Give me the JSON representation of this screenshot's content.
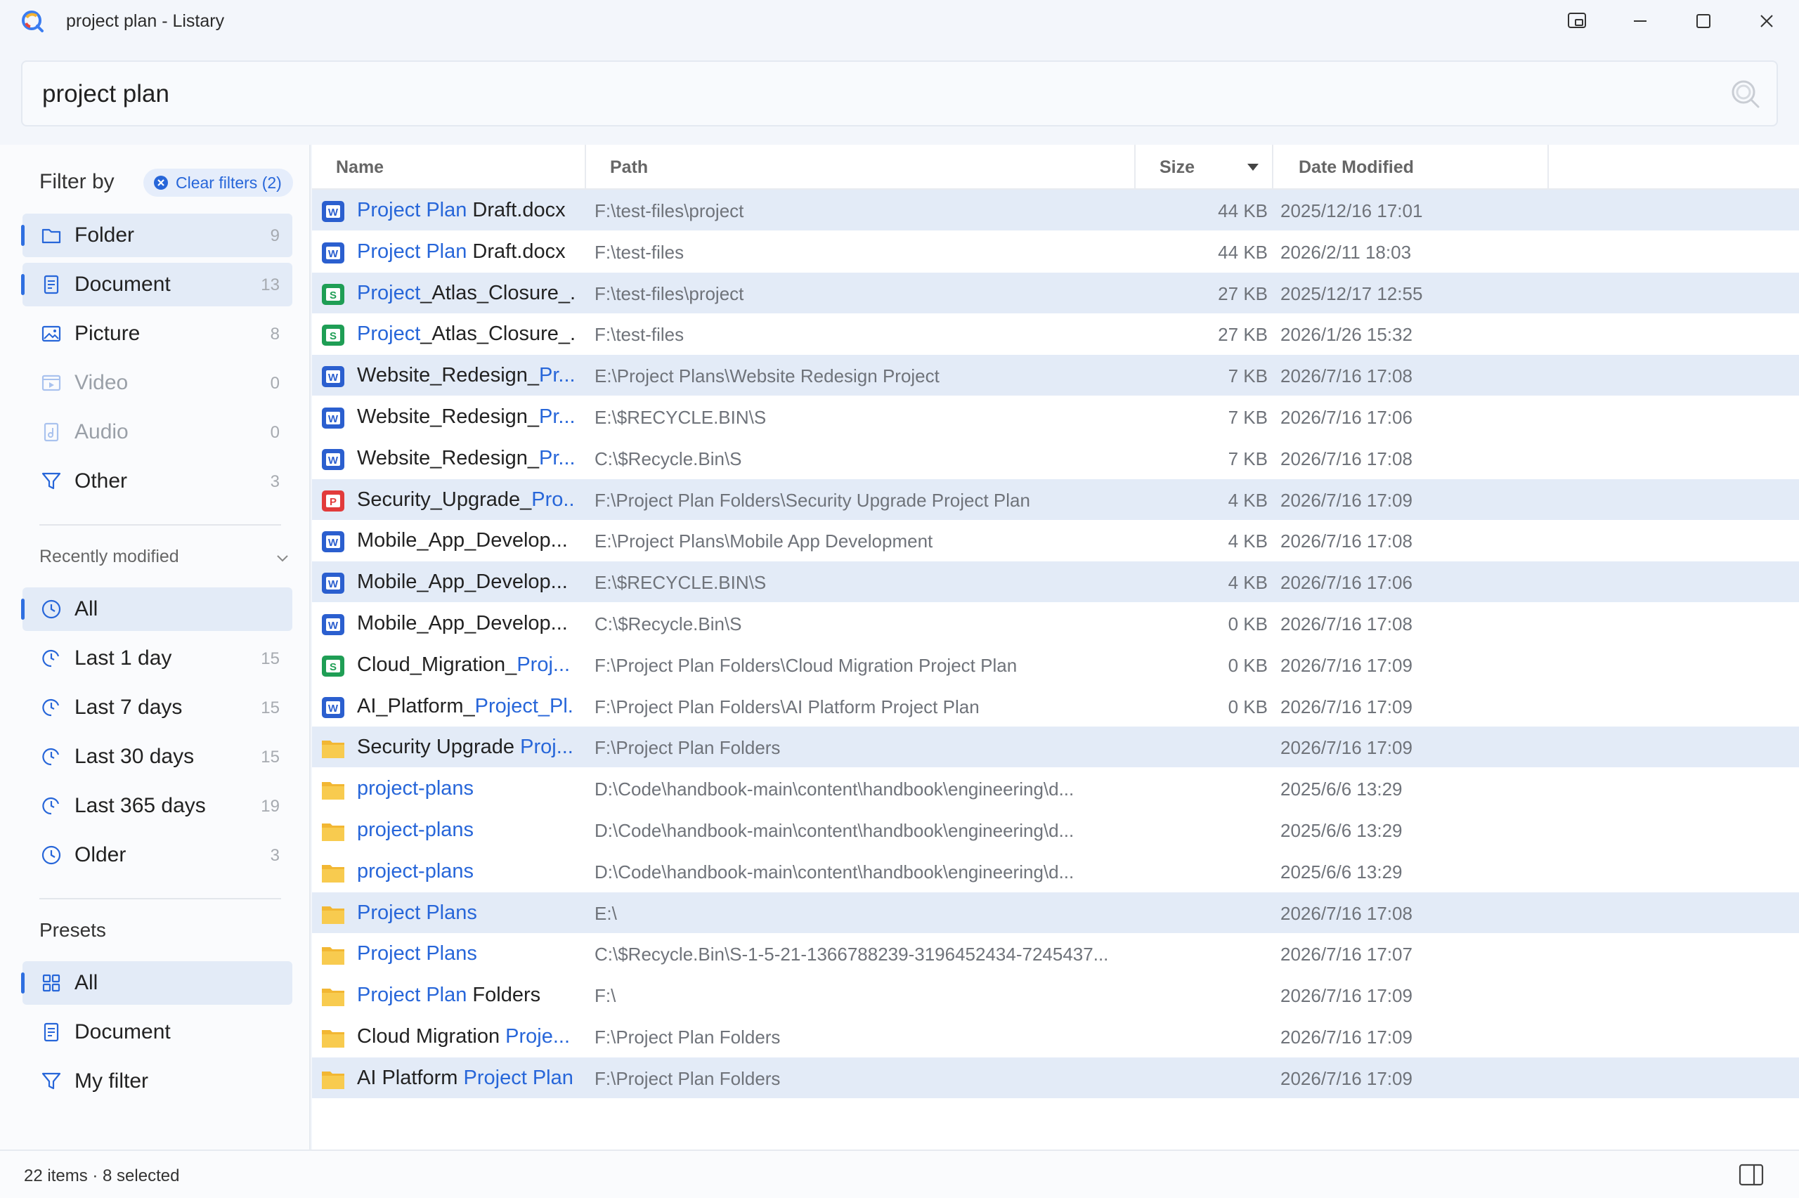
{
  "window": {
    "title": "project plan - Listary",
    "controls": [
      "pin-icon",
      "minimize-icon",
      "maximize-icon",
      "close-icon"
    ]
  },
  "search": {
    "value": "project plan"
  },
  "sidebar": {
    "filter_title": "Filter by",
    "clear_filters": "Clear filters (2)",
    "types": [
      {
        "label": "Folder",
        "count": "9",
        "icon": "folder-icon",
        "active": true
      },
      {
        "label": "Document",
        "count": "13",
        "icon": "document-icon",
        "active": true
      },
      {
        "label": "Picture",
        "count": "8",
        "icon": "picture-icon",
        "active": false
      },
      {
        "label": "Video",
        "count": "0",
        "icon": "video-icon",
        "active": false,
        "dim": true
      },
      {
        "label": "Audio",
        "count": "0",
        "icon": "audio-icon",
        "active": false,
        "dim": true
      },
      {
        "label": "Other",
        "count": "3",
        "icon": "funnel-icon",
        "active": false
      }
    ],
    "recent_title": "Recently modified",
    "recent": [
      {
        "label": "All",
        "count": "",
        "active": true
      },
      {
        "label": "Last 1 day",
        "count": "15",
        "active": false
      },
      {
        "label": "Last 7 days",
        "count": "15",
        "active": false
      },
      {
        "label": "Last 30 days",
        "count": "15",
        "active": false
      },
      {
        "label": "Last 365 days",
        "count": "19",
        "active": false
      },
      {
        "label": "Older",
        "count": "3",
        "active": false
      }
    ],
    "presets_title": "Presets",
    "presets": [
      {
        "label": "All",
        "icon": "grid-icon",
        "active": true
      },
      {
        "label": "Document",
        "icon": "document-icon",
        "active": false
      },
      {
        "label": "My filter",
        "icon": "funnel-icon",
        "active": false
      }
    ]
  },
  "table": {
    "columns": {
      "name": "Name",
      "path": "Path",
      "size": "Size",
      "date": "Date Modified"
    },
    "rows": [
      {
        "icon": "word",
        "hl": "Project Plan",
        "rest": " Draft.docx",
        "path": "F:\\test-files\\project",
        "size": "44 KB",
        "date": "2025/12/16 17:01",
        "selected": true
      },
      {
        "icon": "word",
        "hl": "Project Plan",
        "rest": " Draft.docx",
        "path": "F:\\test-files",
        "size": "44 KB",
        "date": "2026/2/11 18:03",
        "selected": false
      },
      {
        "icon": "excel",
        "hl": "Project",
        "rest": "_Atlas_Closure_...",
        "path": "F:\\test-files\\project",
        "size": "27 KB",
        "date": "2025/12/17 12:55",
        "selected": true
      },
      {
        "icon": "excel",
        "hl": "Project",
        "rest": "_Atlas_Closure_...",
        "path": "F:\\test-files",
        "size": "27 KB",
        "date": "2026/1/26 15:32",
        "selected": false
      },
      {
        "icon": "word",
        "pre": "Website_Redesign_",
        "hl": "Pr...",
        "rest": "",
        "path": "E:\\Project Plans\\Website Redesign Project",
        "size": "7 KB",
        "date": "2026/7/16 17:08",
        "selected": true
      },
      {
        "icon": "word",
        "pre": "Website_Redesign_",
        "hl": "Pr...",
        "rest": "",
        "path": "E:\\$RECYCLE.BIN\\S",
        "size": "7 KB",
        "date": "2026/7/16 17:06",
        "selected": false
      },
      {
        "icon": "word",
        "pre": "Website_Redesign_",
        "hl": "Pr...",
        "rest": "",
        "path": "C:\\$Recycle.Bin\\S",
        "size": "7 KB",
        "date": "2026/7/16 17:08",
        "selected": false
      },
      {
        "icon": "pdf",
        "pre": "Security_Upgrade_",
        "hl": "Pro...",
        "rest": "",
        "path": "F:\\Project Plan Folders\\Security Upgrade Project Plan",
        "size": "4 KB",
        "date": "2026/7/16 17:09",
        "selected": true
      },
      {
        "icon": "word",
        "pre": "Mobile_App_Develop...",
        "hl": "",
        "rest": "",
        "path": "E:\\Project Plans\\Mobile App Development",
        "size": "4 KB",
        "date": "2026/7/16 17:08",
        "selected": false
      },
      {
        "icon": "word",
        "pre": "Mobile_App_Develop...",
        "hl": "",
        "rest": "",
        "path": "E:\\$RECYCLE.BIN\\S",
        "size": "4 KB",
        "date": "2026/7/16 17:06",
        "selected": true
      },
      {
        "icon": "word",
        "pre": "Mobile_App_Develop...",
        "hl": "",
        "rest": "",
        "path": "C:\\$Recycle.Bin\\S",
        "size": "0 KB",
        "date": "2026/7/16 17:08",
        "selected": false
      },
      {
        "icon": "excel",
        "pre": "Cloud_Migration_",
        "hl": "Proj...",
        "rest": "",
        "path": "F:\\Project Plan Folders\\Cloud Migration Project Plan",
        "size": "0 KB",
        "date": "2026/7/16 17:09",
        "selected": false
      },
      {
        "icon": "word",
        "pre": "AI_Platform_",
        "hl": "Project_Pl...",
        "rest": "",
        "path": "F:\\Project Plan Folders\\AI Platform Project Plan",
        "size": "0 KB",
        "date": "2026/7/16 17:09",
        "selected": false
      },
      {
        "icon": "folder",
        "pre": "Security Upgrade ",
        "hl": "Proj...",
        "rest": "",
        "path": "F:\\Project Plan Folders",
        "size": "",
        "date": "2026/7/16 17:09",
        "selected": true
      },
      {
        "icon": "folder",
        "hl": "project-plans",
        "rest": "",
        "path": "D:\\Code\\handbook-main\\content\\handbook\\engineering\\d...",
        "size": "",
        "date": "2025/6/6 13:29",
        "selected": false
      },
      {
        "icon": "folder",
        "hl": "project-plans",
        "rest": "",
        "path": "D:\\Code\\handbook-main\\content\\handbook\\engineering\\d...",
        "size": "",
        "date": "2025/6/6 13:29",
        "selected": false
      },
      {
        "icon": "folder",
        "hl": "project-plans",
        "rest": "",
        "path": "D:\\Code\\handbook-main\\content\\handbook\\engineering\\d...",
        "size": "",
        "date": "2025/6/6 13:29",
        "selected": false
      },
      {
        "icon": "folder",
        "hl": "Project Plans",
        "rest": "",
        "path": "E:\\",
        "size": "",
        "date": "2026/7/16 17:08",
        "selected": true
      },
      {
        "icon": "folder",
        "hl": "Project Plans",
        "rest": "",
        "path": "C:\\$Recycle.Bin\\S-1-5-21-1366788239-3196452434-7245437...",
        "size": "",
        "date": "2026/7/16 17:07",
        "selected": false
      },
      {
        "icon": "folder",
        "hl": "Project Plan",
        "rest": " Folders",
        "path": "F:\\",
        "size": "",
        "date": "2026/7/16 17:09",
        "selected": false
      },
      {
        "icon": "folder",
        "pre": "Cloud Migration ",
        "hl": "Proje...",
        "rest": "",
        "path": "F:\\Project Plan Folders",
        "size": "",
        "date": "2026/7/16 17:09",
        "selected": false
      },
      {
        "icon": "folder",
        "pre": "AI Platform ",
        "hl": "Project Plan",
        "rest": "",
        "path": "F:\\Project Plan Folders",
        "size": "",
        "date": "2026/7/16 17:09",
        "selected": true
      }
    ]
  },
  "status": {
    "text": "22 items · 8 selected"
  },
  "colors": {
    "accent": "#2766d9",
    "selected_row": "#e3ebf7",
    "word": "#2b5fcf",
    "excel": "#1f9e55",
    "pdf": "#e23b3b",
    "folder": "#f7c744"
  }
}
